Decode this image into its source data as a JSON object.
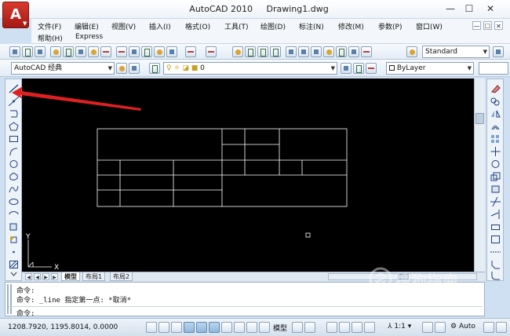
{
  "app": {
    "logo_letter": "A",
    "title": "AutoCAD 2010",
    "document": "Drawing1.dwg"
  },
  "window_controls": {
    "minimize": "—",
    "maximize": "☐",
    "close": "✕"
  },
  "menu": {
    "row1": [
      "文件(F)",
      "编辑(E)",
      "视图(V)",
      "插入(I)",
      "格式(O)",
      "工具(T)",
      "绘图(D)",
      "标注(N)",
      "修改(M)",
      "参数(P)",
      "窗口(W)"
    ],
    "row2": [
      "帮助(H)",
      "Express"
    ]
  },
  "toolbar": {
    "text_style": "Standard",
    "workspace": "AutoCAD 经典",
    "layer": "0",
    "color": "ByLayer"
  },
  "drawing": {
    "ucs_y_label": "Y",
    "ucs_x_label": "X"
  },
  "tabs": {
    "model": "模型",
    "layout1": "布局1",
    "layout2": "布局2"
  },
  "command": {
    "line1": "命令:",
    "line2": "命令: _line 指定第一点: *取消*",
    "prompt": "命令:"
  },
  "status": {
    "coords": "1208.7920,  1195.8014,  0.0000",
    "model_label": "模型",
    "annotation_scale": "1:1",
    "workspace_auto": "Auto"
  },
  "watermark": {
    "text": "搜狗指南",
    "url": "zhinan.sogou.com"
  },
  "colors": {
    "drawing_bg": "#000000",
    "line_color": "#ffffff",
    "annotation_arrow": "#e02020",
    "app_button": "#c62a20"
  }
}
